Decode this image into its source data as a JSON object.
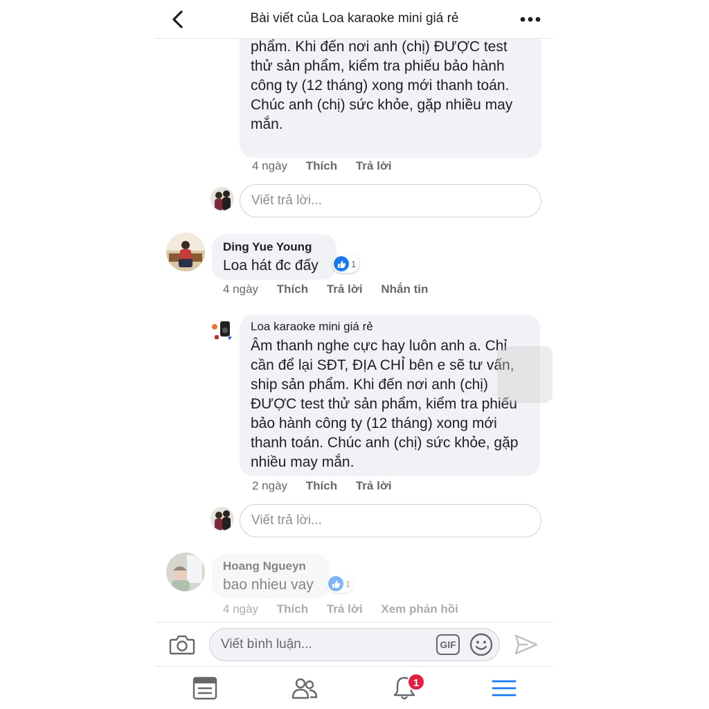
{
  "header": {
    "title": "Bài viết của Loa karaoke mini giá rẻ"
  },
  "comments": {
    "first_reply": {
      "text": "để lại ĐỊA CHỈ bên e sẽ tư vấn, ship sản phẩm. Khi đến nơi anh (chị) ĐƯỢC test thử sản phẩm, kiểm tra phiếu bảo hành công ty (12 tháng) xong mới thanh toán. Chúc anh (chị) sức khỏe, gặp nhiều may mắn.",
      "time": "4 ngày",
      "like": "Thích",
      "reply": "Trả lời"
    },
    "reply_placeholder": "Viết trả lời...",
    "ding": {
      "name": "Ding Yue Young",
      "text": "Loa hát đc đấy",
      "reactions": "1",
      "time": "4 ngày",
      "like": "Thích",
      "reply": "Trả lời",
      "message": "Nhắn tin"
    },
    "shop_reply": {
      "name": "Loa karaoke mini giá rẻ",
      "text": "Âm thanh nghe cực hay luôn anh a. Chỉ cần để lại SĐT, ĐỊA CHỈ bên e sẽ tư vấn, ship sản phẩm. Khi đến nơi anh (chị) ĐƯỢC test thử sản phẩm, kiểm tra phiếu bảo hành công ty (12 tháng) xong mới thanh toán. Chúc anh (chị) sức khỏe, gặp nhiều may mắn.",
      "time": "2 ngày",
      "like": "Thích",
      "reply": "Trả lời"
    },
    "hoang": {
      "name": "Hoang Ngueyn",
      "text": "bao nhieu vay",
      "reactions": "1",
      "time": "4 ngày",
      "like": "Thích",
      "reply": "Trả lời",
      "view_replies": "Xem phản hồi"
    }
  },
  "composer": {
    "placeholder": "Viết bình luận...",
    "gif_label": "GIF"
  },
  "tabbar": {
    "items": [
      "news-feed-icon",
      "friends-icon",
      "notifications-icon",
      "menu-icon"
    ],
    "notification_count": "1"
  },
  "colors": {
    "accent": "#1877f2",
    "bubble": "#f0f2f5",
    "badge": "#e41e3f",
    "muted": "#65676b"
  }
}
